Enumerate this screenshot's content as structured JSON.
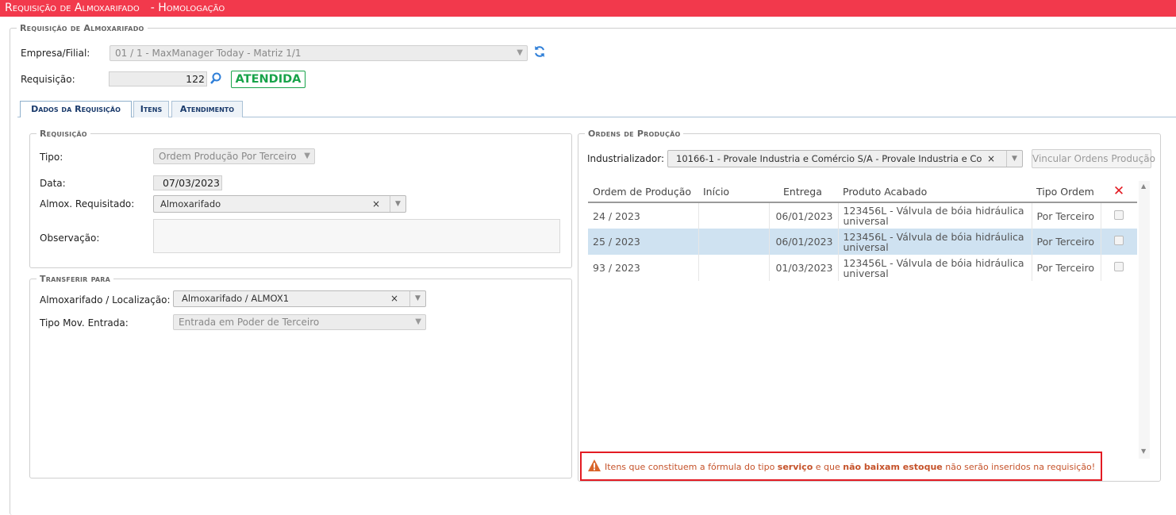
{
  "window": {
    "title": "Requisição de Almoxarifado",
    "environment": "- Homologação"
  },
  "header": {
    "legend": "Requisição de Almoxarifado",
    "empresa_label": "Empresa/Filial:",
    "empresa_value": "01 / 1 - MaxManager Today - Matriz 1/1",
    "requisicao_label": "Requisição:",
    "requisicao_value": "122",
    "status": "ATENDIDA",
    "status_color": "#18a34a"
  },
  "tabs": [
    {
      "label": "Dados da Requisição",
      "active": true
    },
    {
      "label": "Itens",
      "active": false
    },
    {
      "label": "Atendimento",
      "active": false
    }
  ],
  "requisicao": {
    "legend": "Requisição",
    "tipo_label": "Tipo:",
    "tipo_value": "Ordem Produção Por Terceiro",
    "data_label": "Data:",
    "data_value": "07/03/2023",
    "almox_label": "Almox. Requisitado:",
    "almox_value": "Almoxarifado",
    "obs_label": "Observação:",
    "obs_value": ""
  },
  "transferir": {
    "legend": "Transferir para",
    "almox_loc_label": "Almoxarifado / Localização:",
    "almox_loc_value": "Almoxarifado / ALMOX1",
    "tipo_mov_label": "Tipo Mov. Entrada:",
    "tipo_mov_value": "Entrada em Poder de Terceiro"
  },
  "ordens": {
    "legend": "Ordens de Produção",
    "industrializador_label": "Industrializador:",
    "industrializador_value": "10166-1 - Provale Industria e Comércio S/A - Provale Industria e Co",
    "vincular_label": "Vincular Ordens Produção",
    "columns": [
      "Ordem de Produção",
      "Início",
      "Entrega",
      "Produto Acabado",
      "Tipo Ordem"
    ],
    "rows": [
      {
        "ordem": "24 / 2023",
        "inicio": "",
        "entrega": "06/01/2023",
        "produto": "123456L - Válvula de bóia hidráulica universal",
        "tipo": "Por Terceiro",
        "selected": false
      },
      {
        "ordem": "25 / 2023",
        "inicio": "",
        "entrega": "06/01/2023",
        "produto": "123456L - Válvula de bóia hidráulica universal",
        "tipo": "Por Terceiro",
        "selected": true
      },
      {
        "ordem": "93 / 2023",
        "inicio": "",
        "entrega": "01/03/2023",
        "produto": "123456L - Válvula de bóia hidráulica universal",
        "tipo": "Por Terceiro",
        "selected": false
      }
    ]
  },
  "warning": {
    "part1": "Itens que constituem a fórmula do tipo ",
    "bold1": "serviço",
    "part2": " e que ",
    "bold2": "não baixam estoque",
    "part3": " não serão inseridos na requisição!",
    "border_color": "#e31b23",
    "icon_color": "#d9652b"
  },
  "icons": {
    "refresh": "refresh-icon",
    "search": "search-icon",
    "clear": "clear-icon",
    "dropdown": "chevron-down-icon",
    "delete": "delete-x-icon",
    "warning": "warning-triangle-icon"
  },
  "accent_color": "#f2394c"
}
